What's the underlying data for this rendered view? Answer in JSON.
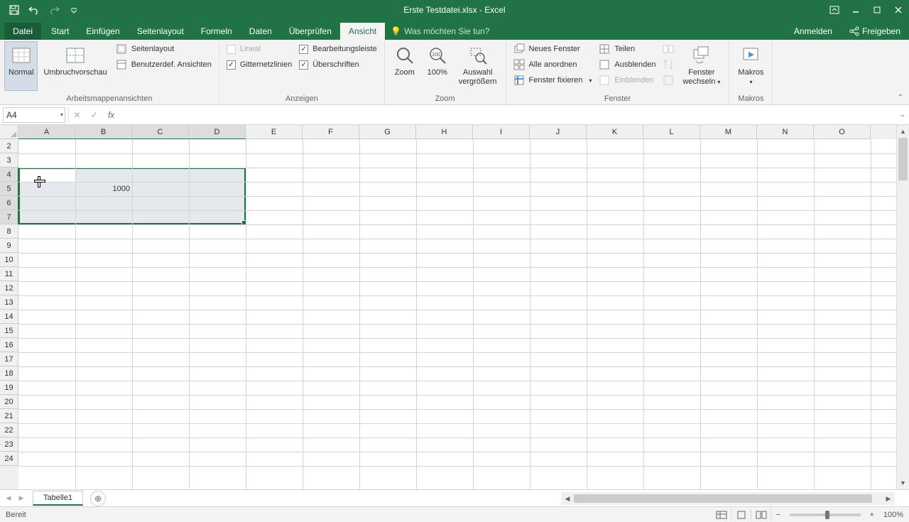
{
  "title": "Erste Testdatei.xlsx - Excel",
  "tabs": {
    "file": "Datei",
    "items": [
      "Start",
      "Einfügen",
      "Seitenlayout",
      "Formeln",
      "Daten",
      "Überprüfen",
      "Ansicht"
    ],
    "active": "Ansicht",
    "tell_me_placeholder": "Was möchten Sie tun?",
    "signin": "Anmelden",
    "share": "Freigeben"
  },
  "ribbon": {
    "views": {
      "label": "Arbeitsmappenansichten",
      "normal": "Normal",
      "pagebreak": "Umbruchvorschau",
      "pagelayout": "Seitenlayout",
      "custom": "Benutzerdef. Ansichten"
    },
    "show": {
      "label": "Anzeigen",
      "ruler": "Lineal",
      "formula_bar": "Bearbeitungsleiste",
      "gridlines": "Gitternetzlinien",
      "headings": "Überschriften"
    },
    "zoom": {
      "label": "Zoom",
      "zoom": "Zoom",
      "hundred": "100%",
      "selection1": "Auswahl",
      "selection2": "vergrößern"
    },
    "window": {
      "label": "Fenster",
      "new_window": "Neues Fenster",
      "arrange": "Alle anordnen",
      "freeze": "Fenster fixieren",
      "split": "Teilen",
      "hide": "Ausblenden",
      "unhide": "Einblenden",
      "switch1": "Fenster",
      "switch2": "wechseln"
    },
    "macros": {
      "label": "Makros",
      "macros": "Makros"
    }
  },
  "namebox": "A4",
  "formula": "",
  "columns": [
    "A",
    "B",
    "C",
    "D",
    "E",
    "F",
    "G",
    "H",
    "I",
    "J",
    "K",
    "L",
    "M",
    "N",
    "O"
  ],
  "rows": [
    2,
    3,
    4,
    5,
    6,
    7,
    8,
    9,
    10,
    11,
    12,
    13,
    14,
    15,
    16,
    17,
    18,
    19,
    20,
    21,
    22,
    23,
    24
  ],
  "selected_cols": [
    "A",
    "B",
    "C",
    "D"
  ],
  "selected_rows": [
    4,
    5,
    6,
    7
  ],
  "cell_B5": "1000",
  "sheet": "Tabelle1",
  "status": "Bereit",
  "zoom": "100%"
}
